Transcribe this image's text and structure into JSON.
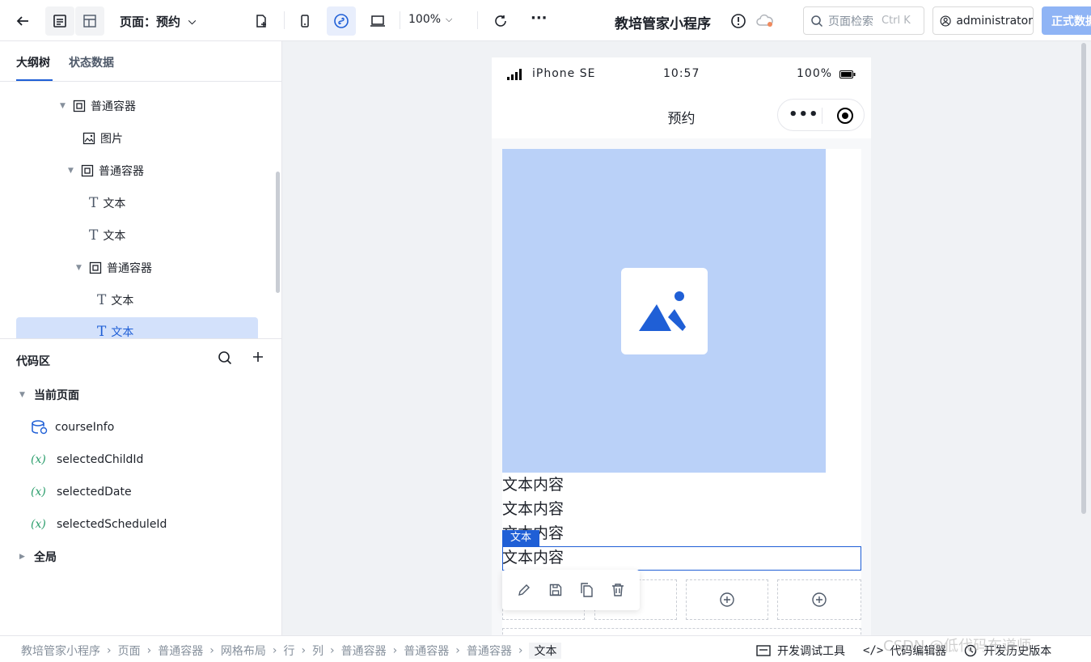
{
  "header": {
    "page_label": "页面：预约",
    "zoom": "100%",
    "more": "···",
    "app_title": "教培管家小程序",
    "search_placeholder": "页面检索",
    "search_shortcut": "Ctrl K",
    "user": "administrator",
    "publish": "正式数据"
  },
  "left_panel": {
    "tabs": [
      "大纲树",
      "状态数据"
    ],
    "tree": [
      {
        "label": "普通容器",
        "type": "container"
      },
      {
        "label": "图片",
        "type": "image"
      },
      {
        "label": "普通容器",
        "type": "container"
      },
      {
        "label": "文本",
        "type": "text"
      },
      {
        "label": "文本",
        "type": "text"
      },
      {
        "label": "普通容器",
        "type": "container"
      },
      {
        "label": "文本",
        "type": "text"
      },
      {
        "label": "文本",
        "type": "text",
        "selected": true
      }
    ],
    "code_area": {
      "title": "代码区",
      "current_page": "当前页面",
      "items": [
        "courseInfo",
        "selectedChildId",
        "selectedDate",
        "selectedScheduleId"
      ],
      "global": "全局",
      "var_glyph": "(x)"
    }
  },
  "phone": {
    "device": "iPhone SE",
    "time": "10:57",
    "battery": "100%",
    "nav_title": "预约",
    "texts": [
      "文本内容",
      "文本内容",
      "文本内容",
      "文本内容"
    ],
    "selected_tag": "文本"
  },
  "breadcrumb": [
    "教培管家小程序",
    "页面",
    "普通容器",
    "网格布局",
    "行",
    "列",
    "普通容器",
    "普通容器",
    "普通容器",
    "文本"
  ],
  "bottom_tools": [
    "开发调试工具",
    "代码编辑器",
    "开发历史版本"
  ],
  "watermark": "CSDN @低代码布道师",
  "colors": {
    "accent": "#1f5fd6",
    "image_placeholder": "#bad1f8",
    "selected_row": "#d3e1fb"
  }
}
